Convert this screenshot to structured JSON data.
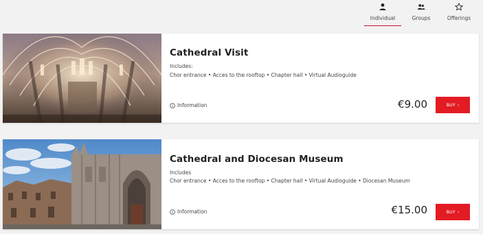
{
  "nav": {
    "tabs": [
      {
        "label": "Individual",
        "icon": "person-icon",
        "active": true
      },
      {
        "label": "Groups",
        "icon": "group-icon",
        "active": false
      },
      {
        "label": "Offerings",
        "icon": "star-icon",
        "active": false
      }
    ],
    "active_color": "#c8102e"
  },
  "cards": [
    {
      "title": "Cathedral Visit",
      "includes_label": "Includes:",
      "includes": "Chor entrance • Acces to the rooftop • Chapter hall • Virtual Audioguide",
      "info_label": "Information",
      "price": "€9.00",
      "buy_label": "BUY",
      "image": "cathedral-interior-photo"
    },
    {
      "title": "Cathedral and Diocesan Museum",
      "includes_label": "Includes",
      "includes": "Chor entrance • Acces to the rooftop • Chapter hall • Virtual Audioguide • Diocesan Museum",
      "info_label": "Information",
      "price": "€15.00",
      "buy_label": "BUY",
      "image": "cathedral-facade-photo"
    }
  ],
  "colors": {
    "buy_button": "#e31b23",
    "background": "#f2f2f2"
  }
}
